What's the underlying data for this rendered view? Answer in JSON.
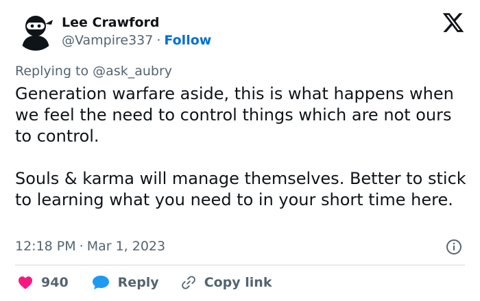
{
  "author": {
    "display_name": "Lee Crawford",
    "handle": "@Vampire337",
    "follow_label": "Follow",
    "separator": "·"
  },
  "reply_context": {
    "prefix": "Replying to",
    "mention": "@ask_aubry"
  },
  "tweet": {
    "paragraphs": [
      "Generation warfare aside, this is what happens when we feel the need to control things which are not ours to control.",
      "Souls & karma will manage themselves. Better to stick to learning what you need to in your short time here."
    ]
  },
  "meta": {
    "time": "12:18 PM",
    "separator": "·",
    "date": "Mar 1, 2023"
  },
  "actions": {
    "like_count": "940",
    "reply_label": "Reply",
    "copy_link_label": "Copy link"
  },
  "colors": {
    "link": "#006fd6",
    "heart": "#f91880",
    "reply_bubble": "#1d9bf0",
    "secondary_text": "#536471",
    "divider": "#cfd9de"
  },
  "icons": {
    "avatar": "ninja-avatar",
    "brand": "x-logo-icon",
    "info": "info-icon",
    "like": "heart-icon",
    "reply": "reply-bubble-icon",
    "copy": "link-icon"
  }
}
